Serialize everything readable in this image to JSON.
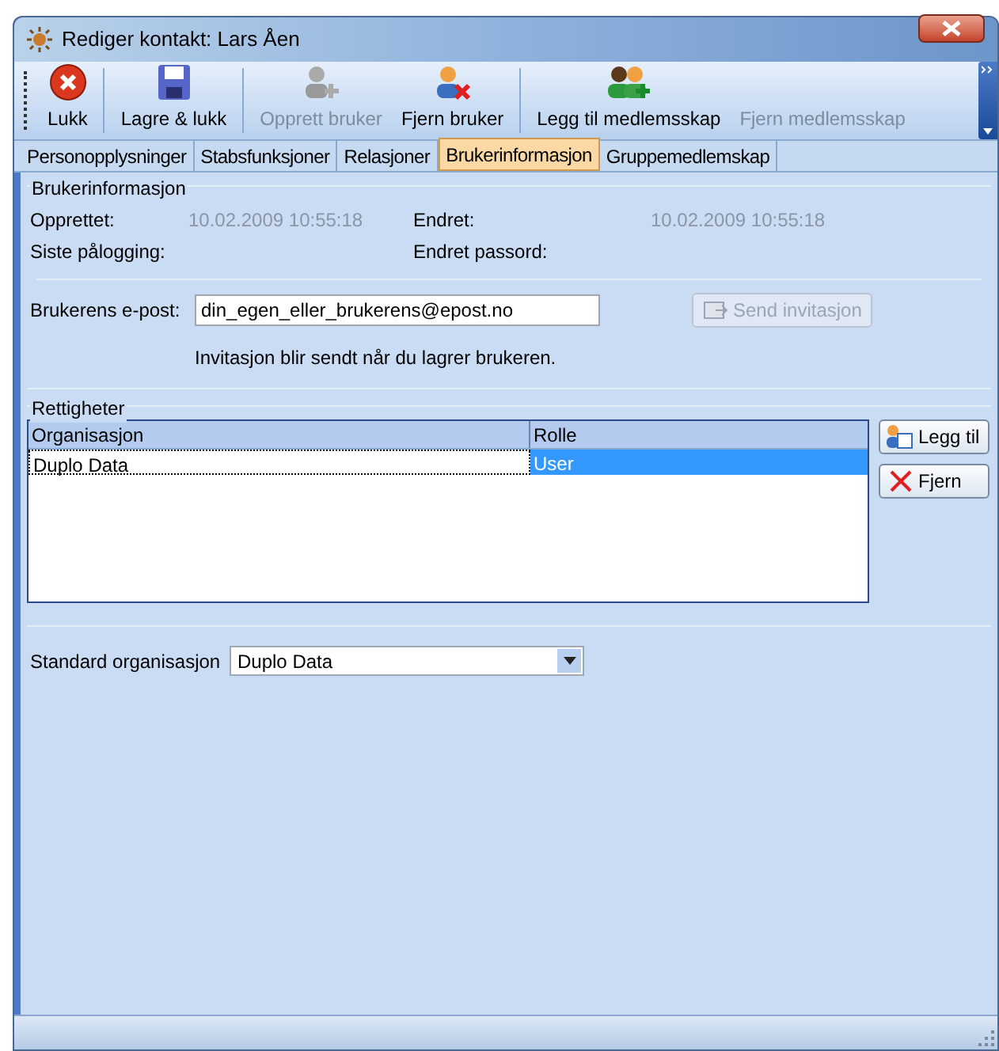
{
  "window": {
    "title": "Rediger kontakt: Lars Åen"
  },
  "toolbar": [
    {
      "label": "Lukk",
      "kind": "close",
      "disabled": false
    },
    {
      "label": "Lagre & lukk",
      "kind": "save",
      "disabled": false
    },
    {
      "label": "Opprett bruker",
      "kind": "adduser",
      "disabled": true
    },
    {
      "label": "Fjern bruker",
      "kind": "removeuser",
      "disabled": false
    },
    {
      "label": "Legg til medlemsskap",
      "kind": "addgroup",
      "disabled": false
    },
    {
      "label": "Fjern medlemsskap",
      "kind": "removegroup",
      "disabled": true
    }
  ],
  "tabs": [
    {
      "label": "Personopplysninger",
      "selected": false
    },
    {
      "label": "Stabsfunksjoner",
      "selected": false
    },
    {
      "label": "Relasjoner",
      "selected": false
    },
    {
      "label": "Brukerinformasjon",
      "selected": true
    },
    {
      "label": "Gruppemedlemskap",
      "selected": false
    }
  ],
  "user_info": {
    "title": "Brukerinformasjon",
    "created_label": "Opprettet:",
    "created": "10.02.2009 10:55:18",
    "changed_label": "Endret:",
    "changed": "10.02.2009 10:55:18",
    "last_login_label": "Siste pålogging:",
    "password_changed_label": "Endret passord:",
    "email_label": "Brukerens e-post:",
    "email": "din_egen_eller_brukerens@epost.no",
    "send_button": {
      "label": "Send invitasjon",
      "disabled": true
    },
    "note": "Invitasjon blir sendt når du lagrer brukeren."
  },
  "rights": {
    "title": "Rettigheter",
    "columns": [
      "Organisasjon",
      "Rolle"
    ],
    "rows": [
      {
        "cells": [
          "Duplo Data",
          "User"
        ],
        "selected": true
      }
    ],
    "add_button": "Legg til",
    "remove_button": "Fjern"
  },
  "default_org": {
    "label": "Standard organisasjon",
    "value": "Duplo Data"
  }
}
